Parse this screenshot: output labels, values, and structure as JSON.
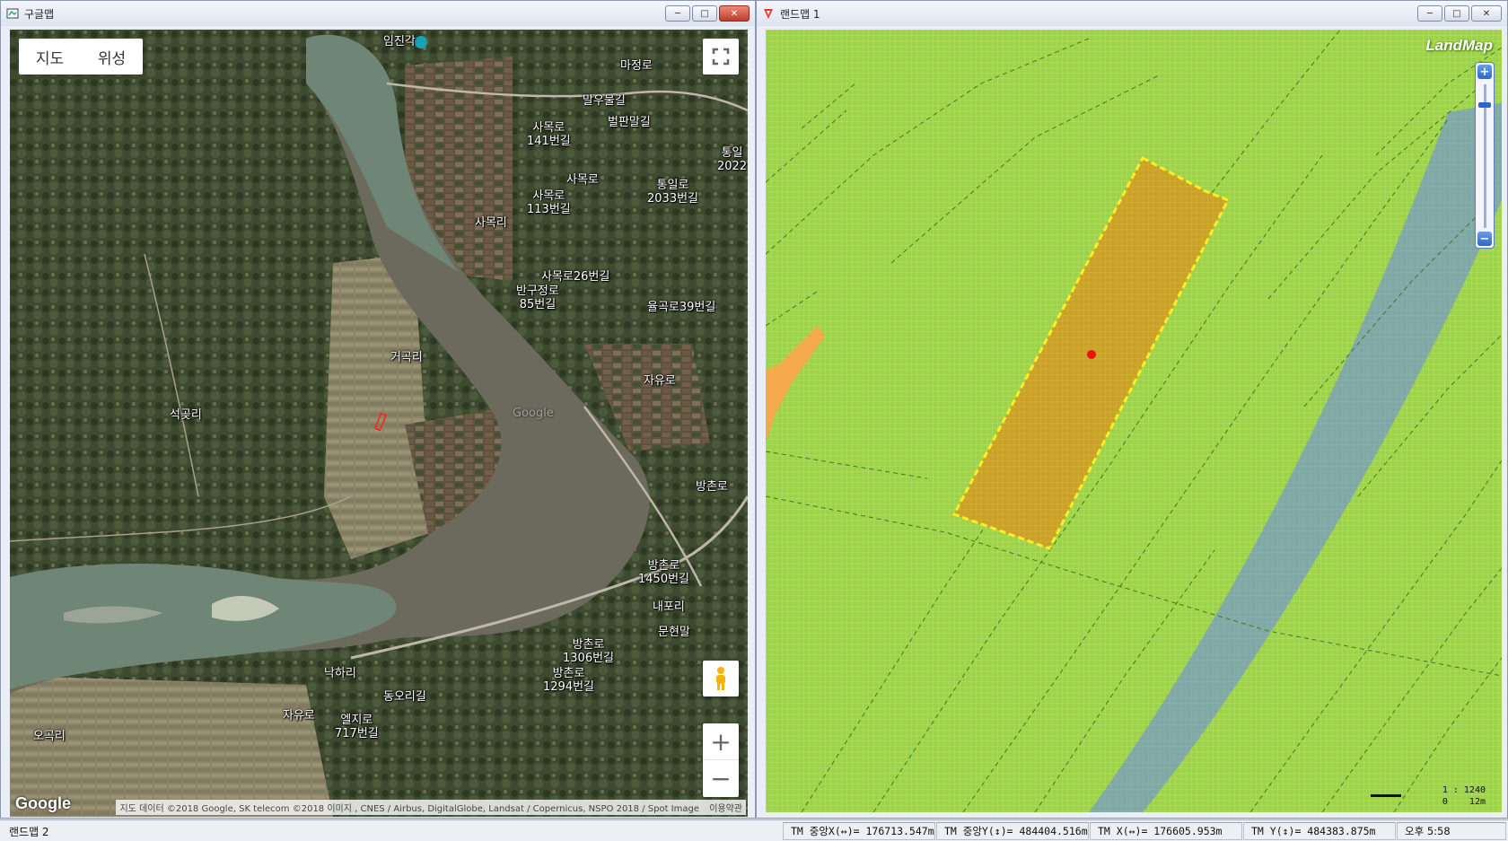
{
  "left_window": {
    "title": "구글맵",
    "maptype": {
      "map_label": "지도",
      "satellite_label": "위성"
    },
    "place_labels": [
      "임진각",
      "마정로",
      "말우물길",
      "벌판말길",
      "사목로\n141번길",
      "사목로",
      "통일로\n2033번길",
      "사목로\n113번길",
      "사목리",
      "사목로26번길",
      "반구정로\n85번길",
      "율곡로39번길",
      "거곡리",
      "자유로",
      "석곶리",
      "방촌로",
      "방촌로\n1450번길",
      "내포리",
      "문현말",
      "방촌로\n1306번길",
      "방촌로\n1294번길",
      "낙하리",
      "동오리길",
      "자유로",
      "엘지로\n717번길",
      "오곡리",
      "통일\n2022",
      "Google"
    ],
    "attribution": "지도 데이터 ©2018 Google, SK telecom ©2018 이미지 , CNES / Airbus, DigitalGlobe, Landsat / Copernicus, NSPO 2018 / Spot Image",
    "terms": "이용약관",
    "logo": "Google",
    "zoom_in": "+",
    "zoom_out": "−"
  },
  "right_window": {
    "title": "랜드맵 1",
    "logo": "LandMap",
    "scale_ratio": "1 : 1240",
    "scale_bar_label": "0    12m"
  },
  "statusbar": {
    "window_name": "랜드맵 2",
    "tm_center_x": "TM 중앙X(↔)= 176713.547m",
    "tm_center_y": "TM 중앙Y(↕)= 484404.516m",
    "tm_x": "TM X(↔)= 176605.953m",
    "tm_y": "TM Y(↕)= 484383.875m",
    "clock": "오후 5:58"
  },
  "colors": {
    "parcel_fill": "#c9a227",
    "parcel_outline": "#ffff33",
    "land_green": "#9bd24f",
    "river_blue": "#7aa6b0",
    "road_orange": "#f4a94c"
  }
}
